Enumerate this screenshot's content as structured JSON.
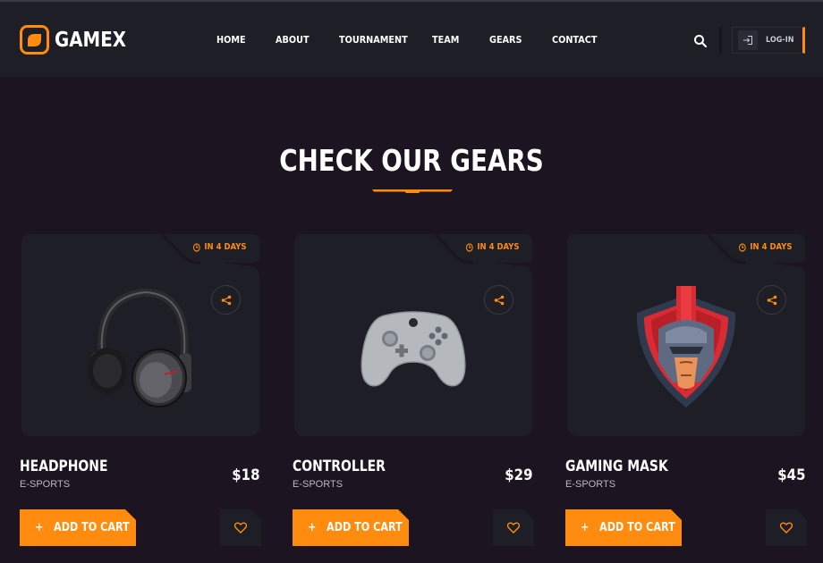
{
  "brand": {
    "name": "GAMEX",
    "accent": "#ff8b0f"
  },
  "nav": [
    "HOME",
    "ABOUT",
    "TOURNAMENT",
    "TEAM",
    "GEARS",
    "CONTACT"
  ],
  "header": {
    "search_icon": "search-icon",
    "login_label": "LOG-IN",
    "login_icon": "login-icon"
  },
  "section": {
    "title": "CHECK OUR GEARS"
  },
  "products": [
    {
      "name": "HEADPHONE",
      "category": "E-SPORTS",
      "price": "$18",
      "badge": "IN 4 DAYS",
      "cart_label": "ADD TO CART",
      "image": "headphones"
    },
    {
      "name": "CONTROLLER",
      "category": "E-SPORTS",
      "price": "$29",
      "badge": "IN 4 DAYS",
      "cart_label": "ADD TO CART",
      "image": "game-controller"
    },
    {
      "name": "GAMING MASK",
      "category": "E-SPORTS",
      "price": "$45",
      "badge": "IN 4 DAYS",
      "cart_label": "ADD TO CART",
      "image": "spartan-mask"
    }
  ]
}
